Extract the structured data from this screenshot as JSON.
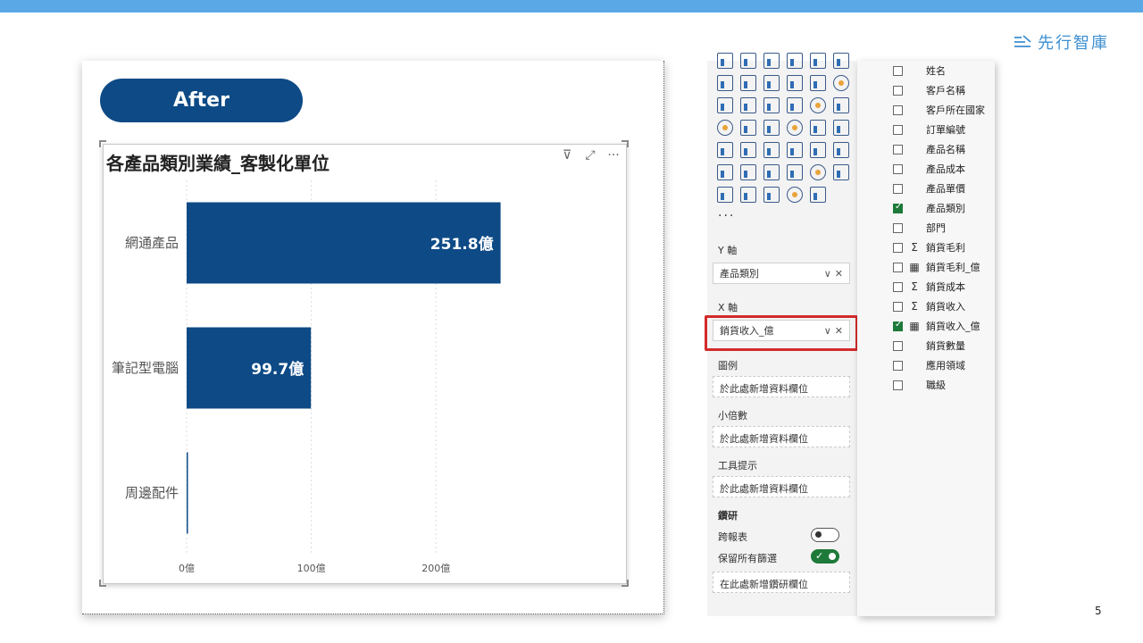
{
  "logo": {
    "text": "先行智庫"
  },
  "page_number": "5",
  "after_label": "After",
  "visual": {
    "title": "各產品類別業績_客製化單位",
    "icons": [
      "filter-icon",
      "focus-mode-icon",
      "more-options-icon"
    ]
  },
  "chart_data": {
    "type": "bar",
    "orientation": "horizontal",
    "title": "各產品類別業績_客製化單位",
    "categories": [
      "網通產品",
      "筆記型電腦",
      "周邊配件"
    ],
    "values": [
      251.8,
      99.7,
      0.5
    ],
    "data_labels": [
      "251.8億",
      "99.7億",
      ""
    ],
    "x_ticks": [
      "0億",
      "100億",
      "200億"
    ],
    "x_tick_values": [
      0,
      100,
      200
    ],
    "xlim": [
      0,
      270
    ],
    "grid": true,
    "bar_color": "#0d4a86"
  },
  "viz_panel": {
    "more": "···",
    "y_axis": {
      "label": "Y 軸",
      "field": "產品類別"
    },
    "x_axis": {
      "label": "X 軸",
      "field": "銷貨收入_億"
    },
    "legend": {
      "label": "圖例",
      "placeholder": "於此處新增資料欄位"
    },
    "small_multiples": {
      "label": "小倍數",
      "placeholder": "於此處新增資料欄位"
    },
    "tooltips": {
      "label": "工具提示",
      "placeholder": "於此處新增資料欄位"
    },
    "drillthrough": {
      "label": "鑽研",
      "cross_report": "跨報表",
      "keep_filters": "保留所有篩選",
      "placeholder": "在此處新增鑽研欄位"
    }
  },
  "fields": [
    {
      "name": "姓名",
      "checked": false,
      "type": ""
    },
    {
      "name": "客戶名稱",
      "checked": false,
      "type": ""
    },
    {
      "name": "客戶所在國家",
      "checked": false,
      "type": ""
    },
    {
      "name": "訂單編號",
      "checked": false,
      "type": ""
    },
    {
      "name": "產品名稱",
      "checked": false,
      "type": ""
    },
    {
      "name": "產品成本",
      "checked": false,
      "type": ""
    },
    {
      "name": "產品單價",
      "checked": false,
      "type": ""
    },
    {
      "name": "產品類別",
      "checked": true,
      "type": ""
    },
    {
      "name": "部門",
      "checked": false,
      "type": ""
    },
    {
      "name": "銷貨毛利",
      "checked": false,
      "type": "Σ"
    },
    {
      "name": "銷貨毛利_億",
      "checked": false,
      "type": "▦"
    },
    {
      "name": "銷貨成本",
      "checked": false,
      "type": "Σ"
    },
    {
      "name": "銷貨收入",
      "checked": false,
      "type": "Σ"
    },
    {
      "name": "銷貨收入_億",
      "checked": true,
      "type": "▦"
    },
    {
      "name": "銷貨數量",
      "checked": false,
      "type": ""
    },
    {
      "name": "應用領域",
      "checked": false,
      "type": ""
    },
    {
      "name": "職級",
      "checked": false,
      "type": ""
    }
  ]
}
